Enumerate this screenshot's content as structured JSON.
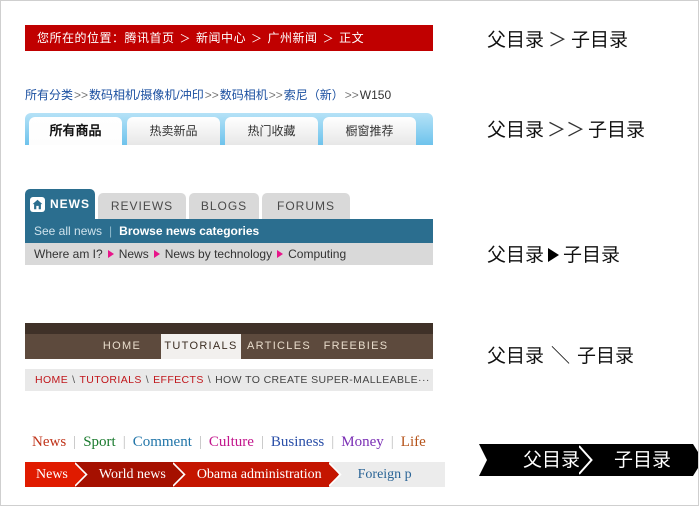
{
  "example1": {
    "label": "您所在的位置：",
    "separator": "＞",
    "items": [
      "腾讯首页",
      "新闻中心",
      "广州新闻",
      "正文"
    ],
    "bg_color": "#c00000",
    "text_color": "#ffffff"
  },
  "example2": {
    "breadcrumb": {
      "root": "所有分类",
      "separator": ">>",
      "items": [
        "数码相机/摄像机/冲印",
        "数码相机",
        "索尼（新）",
        "W150"
      ],
      "link_color": "#1a4fa0"
    },
    "tabs": [
      {
        "label": "所有商品",
        "active": true
      },
      {
        "label": "热卖新品",
        "active": false
      },
      {
        "label": "热门收藏",
        "active": false
      },
      {
        "label": "橱窗推荐",
        "active": false
      }
    ]
  },
  "example3": {
    "tabs": [
      {
        "label": "NEWS",
        "active": true,
        "icon": "home-icon"
      },
      {
        "label": "REVIEWS",
        "active": false
      },
      {
        "label": "BLOGS",
        "active": false
      },
      {
        "label": "FORUMS",
        "active": false
      }
    ],
    "subbar": {
      "see_all": "See all news",
      "divider": "|",
      "browse": "Browse news categories"
    },
    "breadcrumb": {
      "label": "Where am I?",
      "separator": "▶",
      "items": [
        "News",
        "News by technology",
        "Computing"
      ],
      "arrow_color": "#e8168a"
    },
    "accent_color": "#2b6e8f"
  },
  "example4": {
    "nav": [
      {
        "label": "HOME",
        "active": false
      },
      {
        "label": "TUTORIALS",
        "active": true
      },
      {
        "label": "ARTICLES",
        "active": false
      },
      {
        "label": "FREEBIES",
        "active": false
      }
    ],
    "breadcrumb": {
      "separator": "\\",
      "items": [
        "HOME",
        "TUTORIALS",
        "EFFECTS"
      ],
      "current": "HOW TO CREATE SUPER-MALLEABLE···",
      "link_color": "#c0161b"
    },
    "bar_color": "#5d4a3d",
    "top_strip_color": "#3f3128"
  },
  "example5": {
    "section_links": [
      {
        "label": "News",
        "color": "#c0341a"
      },
      {
        "label": "Sport",
        "color": "#1a7a2e"
      },
      {
        "label": "Comment",
        "color": "#1f74a8"
      },
      {
        "label": "Culture",
        "color": "#c2168c"
      },
      {
        "label": "Business",
        "color": "#2a4fa8"
      },
      {
        "label": "Money",
        "color": "#7b2fb5"
      },
      {
        "label": "Life",
        "color": "#b5531a"
      }
    ],
    "separator": "|",
    "crumbs": [
      {
        "label": "News",
        "color": "#e01b00"
      },
      {
        "label": "World news",
        "color": "#a51000"
      },
      {
        "label": "Obama administration",
        "color": "#c41500"
      },
      {
        "label": "Foreign p",
        "color": "#ececec"
      }
    ]
  },
  "annotations": {
    "parent": "父目录",
    "child": "子目录",
    "sep_gt": "＞",
    "sep_dgt": "＞＞",
    "sep_tri": "▶",
    "sep_bs": "＼"
  }
}
